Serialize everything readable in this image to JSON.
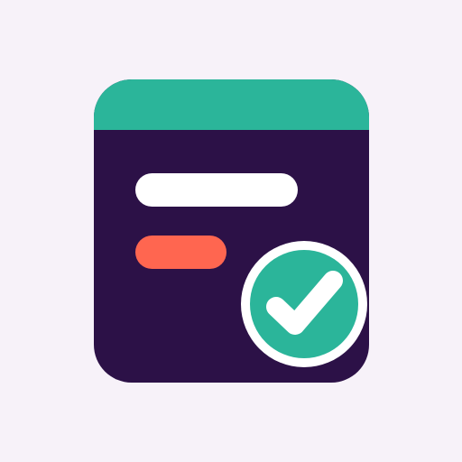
{
  "icon": {
    "name": "task-complete-app-icon",
    "colors": {
      "background": "#F7F2F9",
      "card_body": "#2C1147",
      "card_header": "#2BB59A",
      "line_primary": "#FFFFFF",
      "line_secondary": "#FF6650",
      "badge": "#2BB59A",
      "badge_ring": "#FFFFFF",
      "checkmark": "#FFFFFF"
    },
    "badge_icon": "checkmark-icon"
  }
}
